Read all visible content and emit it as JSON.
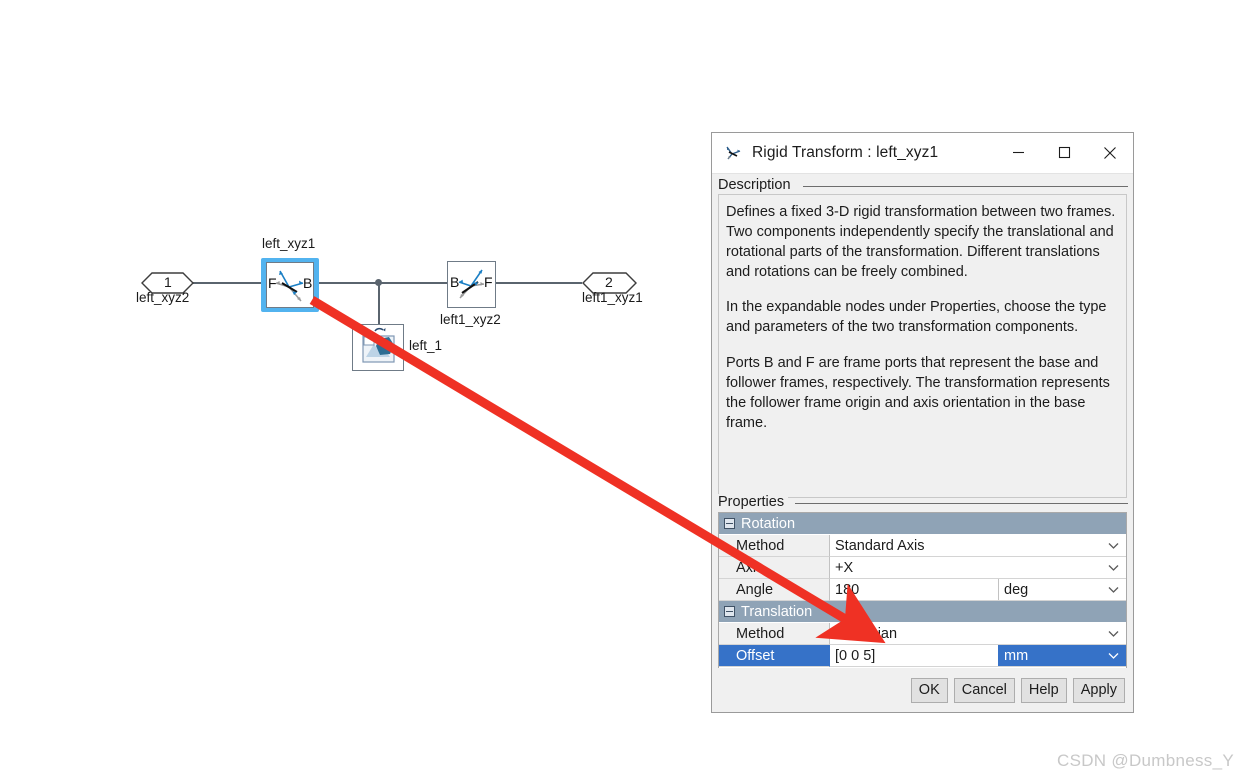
{
  "dialog": {
    "title": "Rigid Transform : left_xyz1",
    "title_icon": "rigid-transform-icon",
    "window_controls": {
      "minimize": "minimize-icon",
      "maximize": "maximize-icon",
      "close": "close-icon"
    },
    "description_group_label": "Description",
    "description_paragraphs": [
      "Defines a fixed 3-D rigid transformation between two frames. Two components independently specify the translational and rotational parts of the transformation. Different translations and rotations can be freely combined.",
      "In the expandable nodes under Properties, choose the type and parameters of the two transformation components.",
      "Ports B and F are frame ports that represent the base and follower frames, respectively. The transformation represents the follower frame origin and axis orientation in the base frame."
    ],
    "properties_group_label": "Properties",
    "properties": [
      {
        "kind": "group",
        "name": "Rotation",
        "expanded": true
      },
      {
        "kind": "row",
        "name": "Method",
        "value": "Standard Axis",
        "unit": null,
        "selected": false
      },
      {
        "kind": "row",
        "name": "Axis",
        "value": "+X",
        "unit": null,
        "selected": false
      },
      {
        "kind": "row",
        "name": "Angle",
        "value": "180",
        "unit": "deg",
        "selected": false
      },
      {
        "kind": "group",
        "name": "Translation",
        "expanded": true
      },
      {
        "kind": "row",
        "name": "Method",
        "value": "Cartesian",
        "unit": null,
        "selected": false
      },
      {
        "kind": "row",
        "name": "Offset",
        "value": "[0 0 5]",
        "unit": "mm",
        "selected": true
      }
    ],
    "buttons": [
      "OK",
      "Cancel",
      "Help",
      "Apply"
    ],
    "colors": {
      "group_header_bg": "#8fa3b6",
      "selection_bg": "#3672c8",
      "panel_bg": "#f0f0f0",
      "titlebar_bg": "#ffffff"
    }
  },
  "canvas": {
    "blocks": [
      {
        "name": "left_xyz2",
        "type": "inport",
        "number": "1",
        "label_pos": "below"
      },
      {
        "name": "left_xyz1",
        "type": "rigid-transform",
        "ports": [
          "F",
          "B"
        ],
        "selected": true,
        "label_pos": "above"
      },
      {
        "name": "left_1",
        "type": "file-solid",
        "label_pos": "right"
      },
      {
        "name": "left1_xyz2",
        "type": "rigid-transform",
        "ports": [
          "B",
          "F"
        ],
        "selected": false,
        "label_pos": "below"
      },
      {
        "name": "left1_xyz1",
        "type": "outport",
        "number": "2",
        "label_pos": "below"
      }
    ]
  },
  "annotation": {
    "arrow_color": "#ef3124",
    "from": "left_xyz1 block",
    "to": "Offset value field"
  },
  "watermark": "CSDN @Dumbness_Y"
}
